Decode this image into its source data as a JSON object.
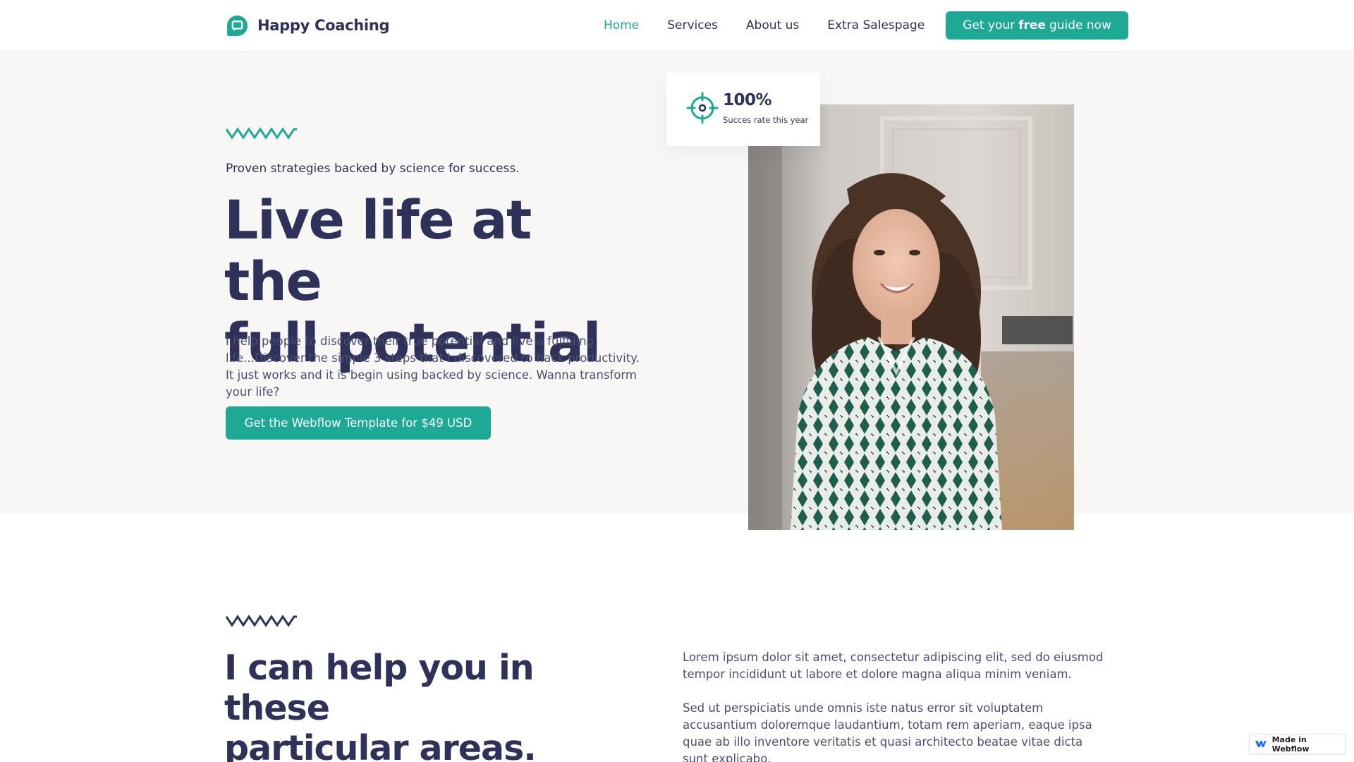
{
  "nav": {
    "brand_name": "Happy Coaching",
    "links": [
      "Home",
      "Services",
      "About us",
      "Extra Salespage"
    ],
    "active_link": "Home",
    "cta_prefix": "Get your",
    "cta_bold": "free",
    "cta_suffix": "guide now"
  },
  "hero": {
    "eyebrow": "Proven strategies backed by science for success.",
    "title_line1": "Live life at the",
    "title_line2": "full potential",
    "body": "I help people to discover their true potential and live a fulfilling life...Discover the simple 3 steps that I discovered to hack productivity. It just works and it is begin using backed by science. Wanna transform your life?",
    "cta": "Get the Webflow Template for $49 USD",
    "stat": {
      "value": "100%",
      "label": "Succes rate this year"
    }
  },
  "section2": {
    "title_line1": "I can help you in these",
    "title_line2": "particular areas.",
    "paragraph1": "Lorem ipsum dolor sit amet, consectetur adipiscing elit, sed do eiusmod tempor incididunt ut labore et dolore magna aliqua minim veniam.",
    "paragraph2": "Sed ut perspiciatis unde omnis iste natus error sit voluptatem accusantium doloremque laudantium, totam rem aperiam, eaque ipsa quae ab illo inventore veritatis et quasi architecto beatae vitae dicta sunt explicabo."
  },
  "badge": {
    "label": "Made in Webflow"
  },
  "icons": {
    "brand": "chat-bubble-icon",
    "stat": "target-icon",
    "hero_divider": "zigzag-icon",
    "section_divider": "zigzag-icon",
    "badge": "webflow-logo-icon"
  },
  "colors": {
    "accent": "#1ea896",
    "heading": "#2e3159",
    "hero_background": "#f8f7f6"
  }
}
